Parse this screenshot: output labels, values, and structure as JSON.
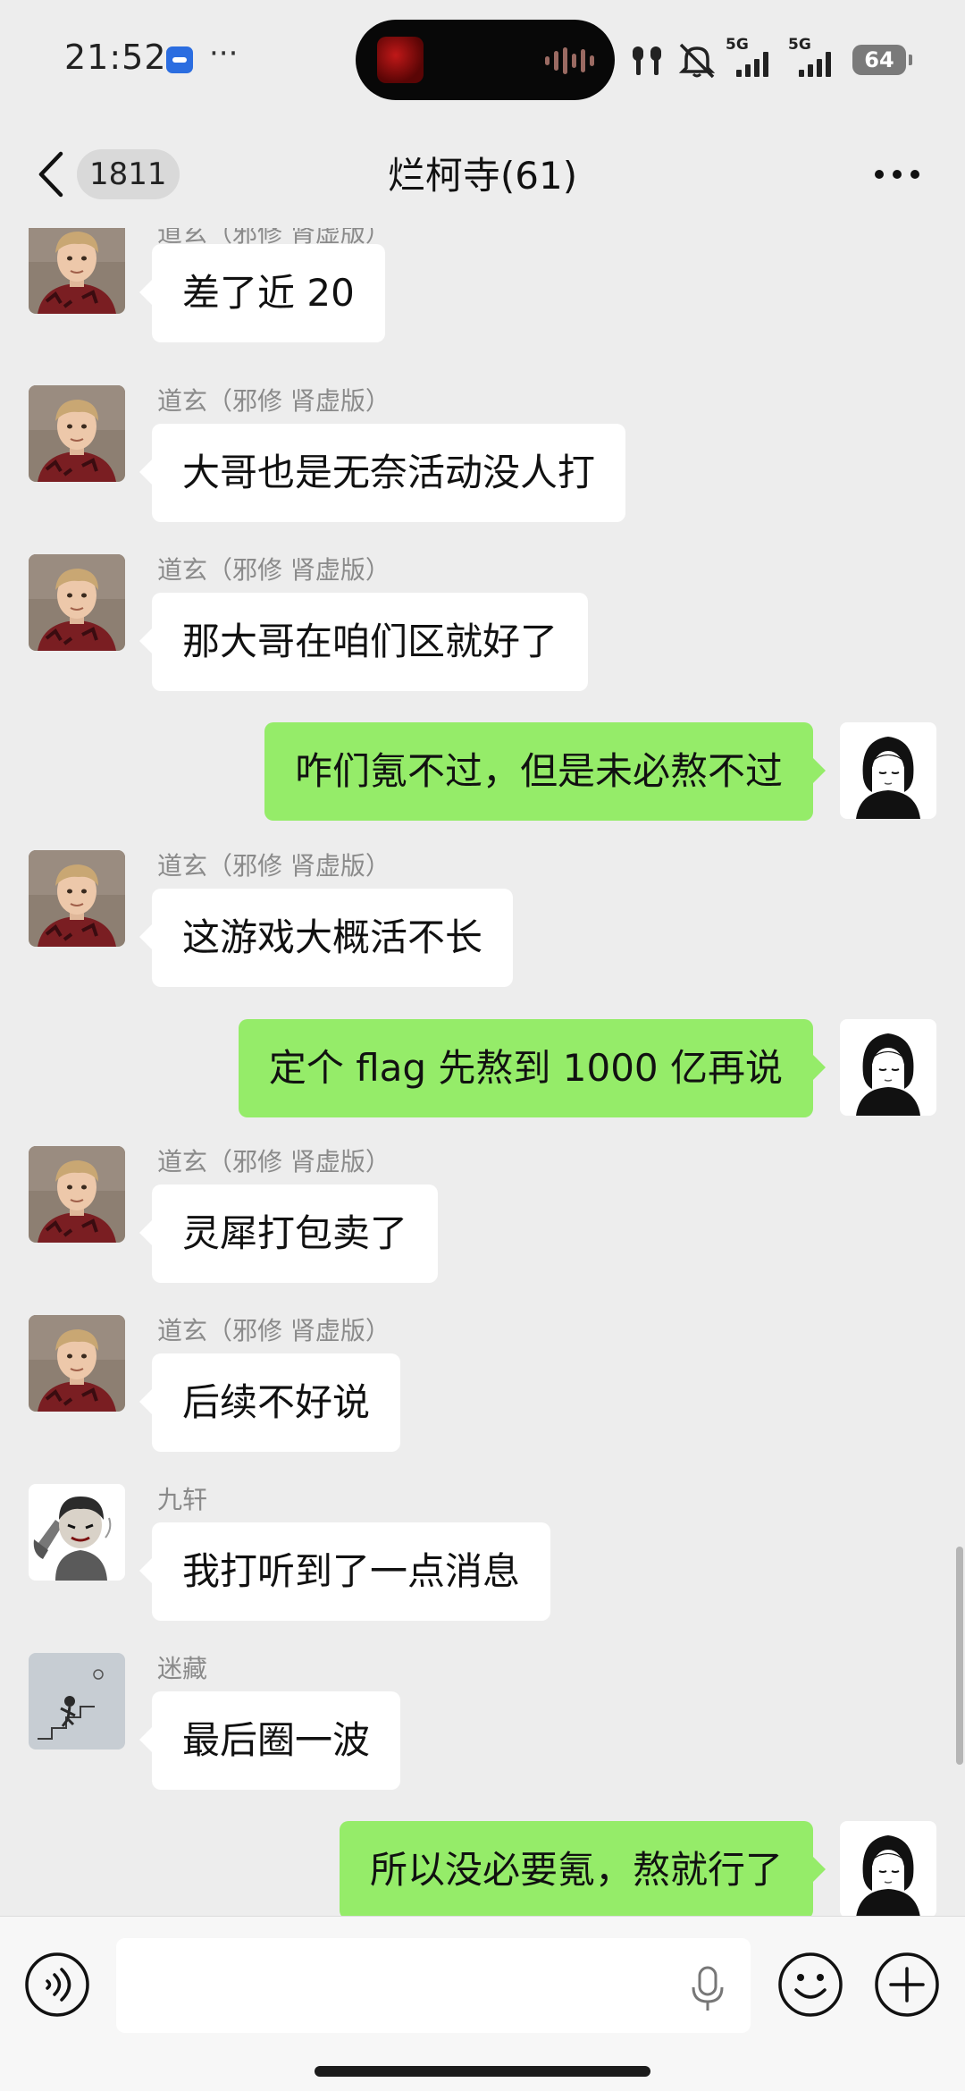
{
  "status_bar": {
    "time": "21:52",
    "more_indicator": "···",
    "network_1": "5G",
    "network_2": "5G",
    "battery": "64",
    "icons": [
      "app-notification-icon",
      "earbuds-icon",
      "mute-icon",
      "signal-icon",
      "battery-icon"
    ]
  },
  "header": {
    "unread_count": "1811",
    "title": "烂柯寺(61)",
    "icons": [
      "back-arrow-icon",
      "more-options-icon"
    ]
  },
  "messages": [
    {
      "direction": "in",
      "sender": "道玄（邪修 肾虚版）",
      "text": "差了近 20",
      "avatar": "boy-portrait-avatar"
    },
    {
      "direction": "in",
      "sender": "道玄（邪修 肾虚版）",
      "text": "大哥也是无奈活动没人打",
      "avatar": "boy-portrait-avatar"
    },
    {
      "direction": "in",
      "sender": "道玄（邪修 肾虚版）",
      "text": "那大哥在咱们区就好了",
      "avatar": "boy-portrait-avatar"
    },
    {
      "direction": "out",
      "sender": "",
      "text": "咋们氪不过，但是未必熬不过",
      "avatar": "sketch-girl-avatar"
    },
    {
      "direction": "in",
      "sender": "道玄（邪修 肾虚版）",
      "text": "这游戏大概活不长",
      "avatar": "boy-portrait-avatar"
    },
    {
      "direction": "out",
      "sender": "",
      "text": "定个 flag 先熬到 1000 亿再说",
      "avatar": "sketch-girl-avatar"
    },
    {
      "direction": "in",
      "sender": "道玄（邪修 肾虚版）",
      "text": "灵犀打包卖了",
      "avatar": "boy-portrait-avatar"
    },
    {
      "direction": "in",
      "sender": "道玄（邪修 肾虚版）",
      "text": "后续不好说",
      "avatar": "boy-portrait-avatar"
    },
    {
      "direction": "in",
      "sender": "九轩",
      "text": "我打听到了一点消息",
      "avatar": "cartoon-warrior-avatar"
    },
    {
      "direction": "in",
      "sender": "迷藏",
      "text": "最后圈一波",
      "avatar": "stairs-sketch-avatar"
    },
    {
      "direction": "out",
      "sender": "",
      "text": "所以没必要氪，熬就行了",
      "avatar": "sketch-girl-avatar"
    }
  ],
  "input_bar": {
    "value": "",
    "icons": [
      "voice-icon",
      "microphone-icon",
      "emoji-icon",
      "plus-icon"
    ]
  },
  "colors": {
    "background": "#ededed",
    "incoming_bubble": "#ffffff",
    "outgoing_bubble": "#95ec69",
    "sender_name": "#8a8a8a"
  }
}
